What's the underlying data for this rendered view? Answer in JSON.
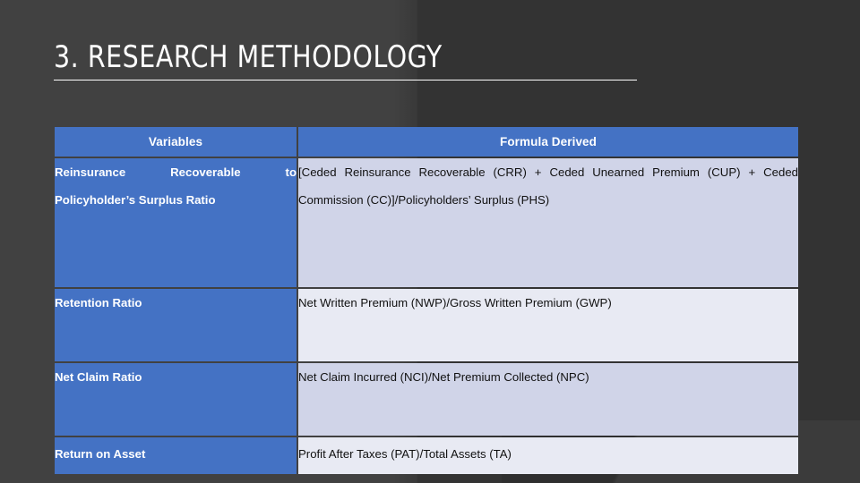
{
  "slide": {
    "title": "3. RESEARCH METHODOLOGY",
    "accent_color": "#4472C4",
    "background_left": "#414141",
    "background_right": "#333333",
    "row_tint_dark": "#D0D4E8",
    "row_tint_light": "#E8EAF3"
  },
  "table": {
    "headers": {
      "variables": "Variables",
      "formula": "Formula Derived"
    },
    "rows": [
      {
        "variable": "Reinsurance Recoverable to Policyholder’s Surplus Ratio",
        "formula": "[Ceded Reinsurance Recoverable (CRR) + Ceded Unearned Premium (CUP) + Ceded Commission (CC)]/Policyholders’ Surplus (PHS)"
      },
      {
        "variable": "Retention Ratio",
        "formula": "Net Written Premium (NWP)/Gross Written Premium (GWP)"
      },
      {
        "variable": "Net Claim Ratio",
        "formula": "Net Claim Incurred (NCI)/Net Premium Collected (NPC)"
      },
      {
        "variable": "Return on Asset",
        "formula": "Profit After Taxes (PAT)/Total Assets (TA)"
      }
    ]
  }
}
